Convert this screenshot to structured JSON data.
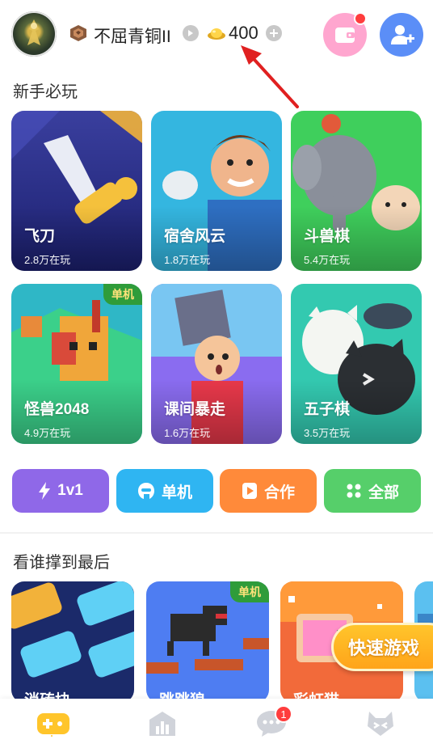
{
  "header": {
    "rank_label": "不屈青铜II",
    "coins": "400",
    "colors": {
      "wallet": "#ffa6cf",
      "add_friend": "#5b8ef7",
      "notification_dot": "#ff3d3d"
    }
  },
  "sections": {
    "newbie": {
      "title": "新手必玩",
      "games": [
        {
          "name": "飞刀",
          "plays": "2.8万在玩",
          "tag": ""
        },
        {
          "name": "宿舍风云",
          "plays": "1.8万在玩",
          "tag": ""
        },
        {
          "name": "斗兽棋",
          "plays": "5.4万在玩",
          "tag": ""
        },
        {
          "name": "怪兽2048",
          "plays": "4.9万在玩",
          "tag": "单机"
        },
        {
          "name": "课间暴走",
          "plays": "1.6万在玩",
          "tag": ""
        },
        {
          "name": "五子棋",
          "plays": "3.5万在玩",
          "tag": ""
        }
      ]
    },
    "categories": [
      {
        "label": "1v1",
        "icon": "lightning-icon",
        "color": "#8f68e8"
      },
      {
        "label": "单机",
        "icon": "helmet-icon",
        "color": "#2fb5f2"
      },
      {
        "label": "合作",
        "icon": "play-icon",
        "color": "#ff8a3a"
      },
      {
        "label": "全部",
        "icon": "grid-icon",
        "color": "#56cf6a"
      }
    ],
    "survival": {
      "title": "看谁撑到最后",
      "games": [
        {
          "name": "消砖块",
          "tag": ""
        },
        {
          "name": "跳跳狼",
          "tag": "单机"
        },
        {
          "name": "彩虹猫",
          "tag": ""
        }
      ]
    }
  },
  "quick_game": {
    "label": "快速游戏"
  },
  "bottom_nav": {
    "items": [
      {
        "name": "games",
        "icon": "gamepad-icon",
        "active": true
      },
      {
        "name": "ranking",
        "icon": "chart-house-icon",
        "active": false
      },
      {
        "name": "messages",
        "icon": "chat-icon",
        "badge": "1",
        "active": false
      },
      {
        "name": "profile",
        "icon": "face-icon",
        "active": false
      }
    ]
  }
}
